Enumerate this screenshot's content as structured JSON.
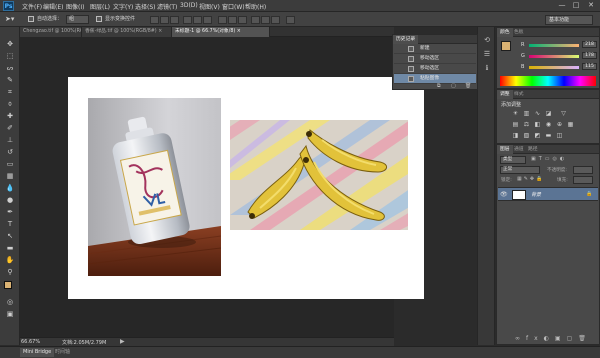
{
  "app": {
    "logo": "Ps"
  },
  "menu": {
    "items": [
      {
        "label": "文件(F)"
      },
      {
        "label": "编辑(E)"
      },
      {
        "label": "图像(I)"
      },
      {
        "label": "图层(L)"
      },
      {
        "label": "文字(Y)"
      },
      {
        "label": "选择(S)"
      },
      {
        "label": "滤镜(T)"
      },
      {
        "label": "3D(D)"
      },
      {
        "label": "视图(V)"
      },
      {
        "label": "窗口(W)"
      },
      {
        "label": "帮助(H)"
      }
    ],
    "controls": {
      "minimize": "—",
      "maximize": "□",
      "close": "✕"
    }
  },
  "options": {
    "auto_select_label": "自动选择：",
    "auto_select_value": "组",
    "show_transform_label": "显示变换控件",
    "workspace": "基本功能"
  },
  "tabs": [
    {
      "label": "Chengzao.tif @ 100%(RGB/8#) ×"
    },
    {
      "label": "香蕉-绿品.tif @ 100%(RGB/8#) ×"
    },
    {
      "label": "未标题-1 @ 66.7%(对象/8) ×"
    }
  ],
  "status": {
    "zoom": "66.67%",
    "doc_size": "文档:2.05M/2.79M",
    "arrow": "▶"
  },
  "bottom": {
    "bridge": "Mini Bridge",
    "timeline": "时间轴"
  },
  "history": {
    "tabs": [
      "历史记录"
    ],
    "rows": [
      {
        "label": "新建",
        "active": false
      },
      {
        "label": "移动选区",
        "active": false
      },
      {
        "label": "移动选区",
        "active": false
      },
      {
        "label": "粘贴图像",
        "active": true
      }
    ]
  },
  "color": {
    "tabs": [
      "颜色",
      "色板"
    ],
    "channels": [
      {
        "name": "R",
        "value": "218"
      },
      {
        "name": "G",
        "value": "178"
      },
      {
        "name": "B",
        "value": "115"
      }
    ],
    "foreground": "#dab273"
  },
  "adjustments": {
    "tabs": [
      "调整",
      "样式"
    ],
    "title": "添加调整"
  },
  "layers": {
    "tabs": [
      "图层",
      "通道",
      "路径"
    ],
    "kind": "类型",
    "blend_mode": "正常",
    "opacity_label": "不透明度:",
    "lock_label": "锁定:",
    "fill_label": "填充:",
    "layer_name": "背景"
  }
}
